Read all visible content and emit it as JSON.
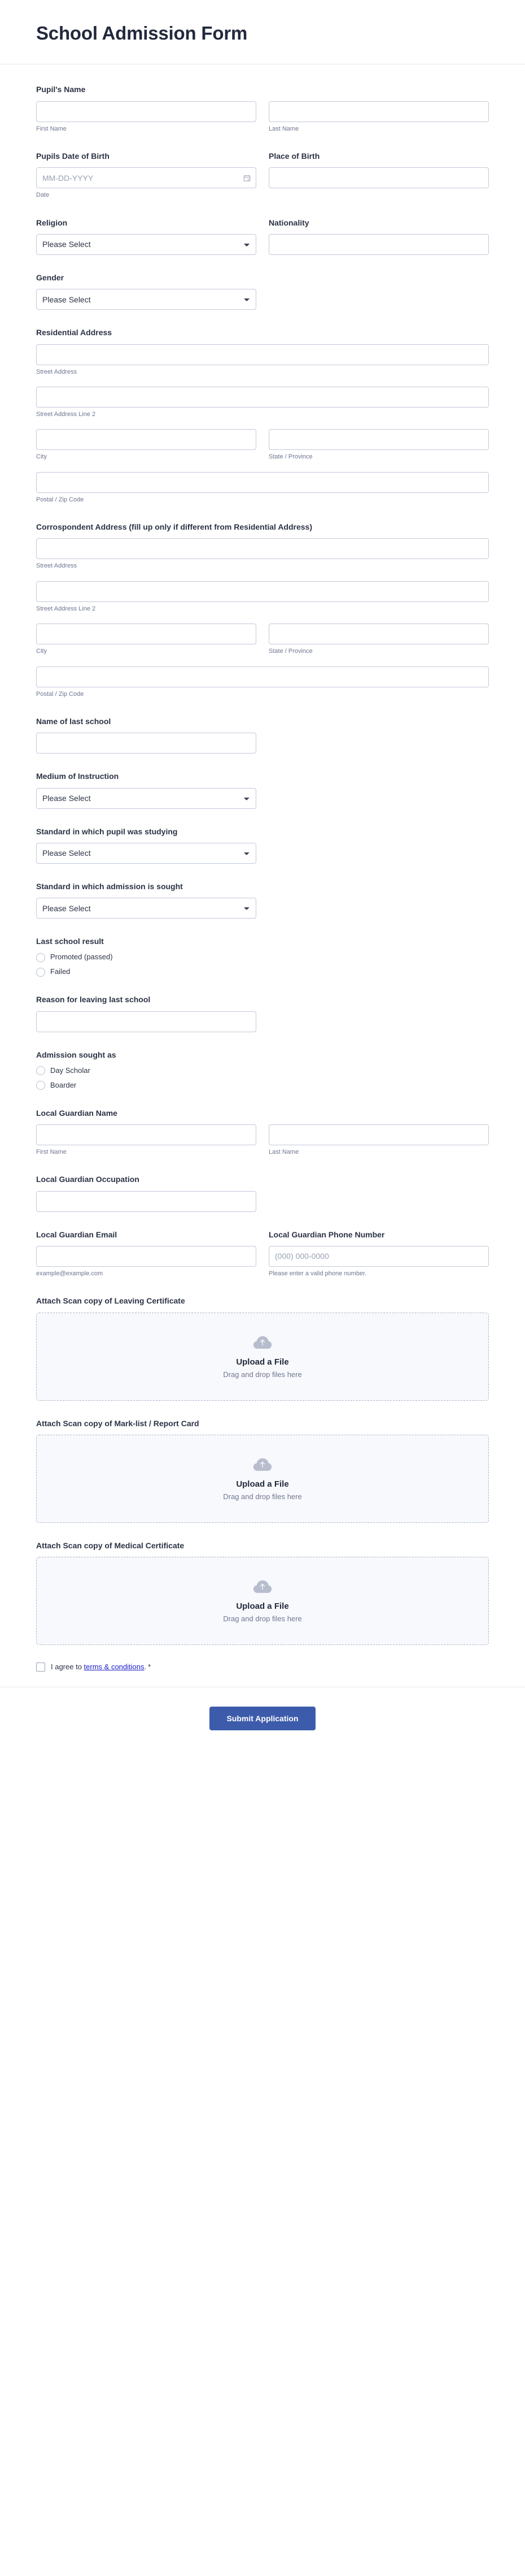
{
  "header": {
    "title": "School Admission Form"
  },
  "common": {
    "please_select": "Please Select",
    "first_name": "First Name",
    "last_name": "Last Name",
    "street_address": "Street Address",
    "street_address_2": "Street Address Line 2",
    "city": "City",
    "state_province": "State / Province",
    "postal_zip": "Postal / Zip Code",
    "date_sub": "Date",
    "date_placeholder": "MM-DD-YYYY"
  },
  "fields": {
    "pupils_name": {
      "label": "Pupil's Name"
    },
    "dob": {
      "label": "Pupils Date of Birth"
    },
    "place_of_birth": {
      "label": "Place of Birth"
    },
    "religion": {
      "label": "Religion",
      "value": "Please Select"
    },
    "nationality": {
      "label": "Nationality"
    },
    "gender": {
      "label": "Gender",
      "value": "Please Select"
    },
    "residential_address": {
      "label": "Residential Address"
    },
    "correspondent_address": {
      "label": "Corrospondent Address (fill up only if different from Residential Address)"
    },
    "last_school": {
      "label": "Name of last school"
    },
    "medium_of_instruction": {
      "label": "Medium of Instruction",
      "value": "Please Select"
    },
    "standard_studying": {
      "label": "Standard in which pupil was studying",
      "value": "Please Select"
    },
    "standard_sought": {
      "label": "Standard in which admission is sought",
      "value": "Please Select"
    },
    "last_school_result": {
      "label": "Last school result",
      "options": [
        "Promoted (passed)",
        "Failed"
      ]
    },
    "reason_leaving": {
      "label": "Reason for leaving last school"
    },
    "admission_sought_as": {
      "label": "Admission sought as",
      "options": [
        "Day Scholar",
        "Boarder"
      ]
    },
    "guardian_name": {
      "label": "Local Guardian Name"
    },
    "guardian_occupation": {
      "label": "Local Guardian Occupation"
    },
    "guardian_email": {
      "label": "Local Guardian Email",
      "sub": "example@example.com"
    },
    "guardian_phone": {
      "label": "Local Guardian Phone Number",
      "placeholder": "(000) 000-0000",
      "sub": "Please enter a valid phone number."
    },
    "upload_leaving_certificate": {
      "label": "Attach Scan copy of Leaving Certificate"
    },
    "upload_marklist": {
      "label": "Attach Scan copy of Mark-list / Report Card"
    },
    "upload_medical": {
      "label": "Attach Scan copy of Medical Certificate"
    }
  },
  "upload": {
    "title": "Upload a File",
    "subtitle": "Drag and drop files here"
  },
  "agreement": {
    "prefix": "I agree to ",
    "link": "terms & conditions",
    "suffix": ".",
    "required_mark": "*"
  },
  "footer": {
    "submit_label": "Submit Application"
  },
  "colors": {
    "accent": "#3d5bab",
    "link": "#2020c8",
    "text": "#2c3345",
    "muted": "#6f7691",
    "border": "#c3c9d8",
    "dropzone_bg": "#f8f9fc"
  }
}
